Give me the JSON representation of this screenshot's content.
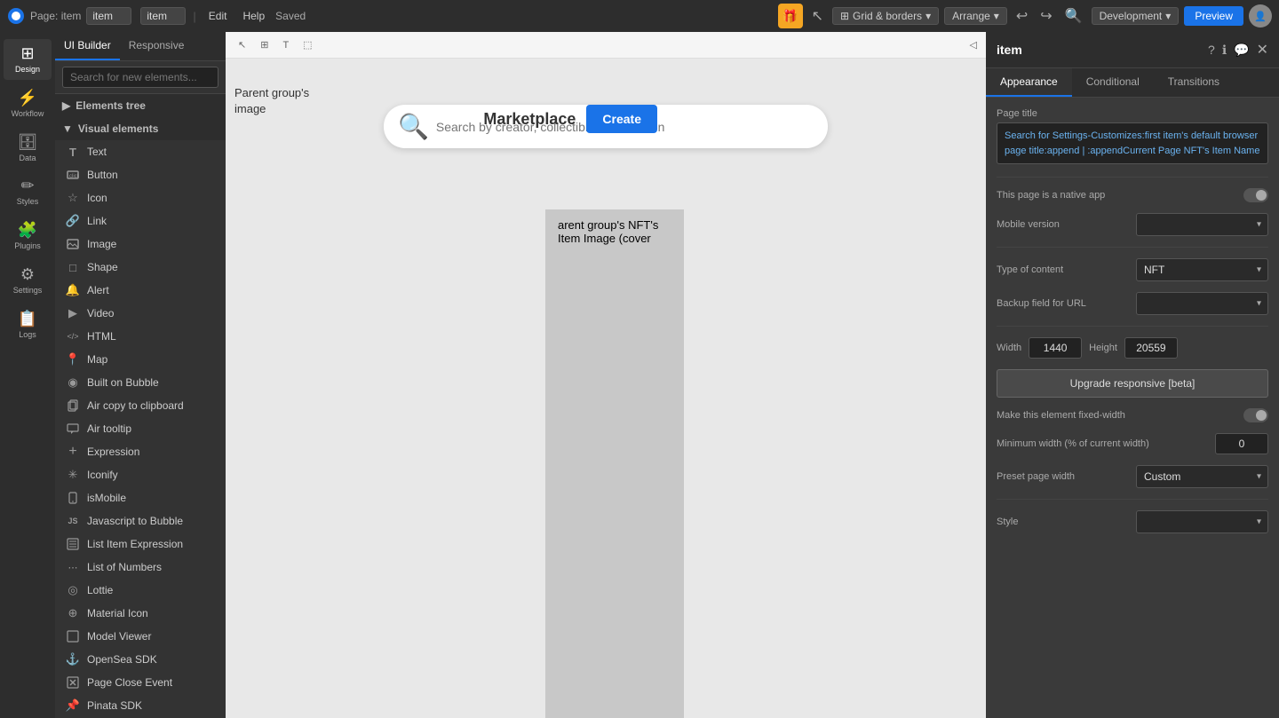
{
  "topbar": {
    "page_label": "Page: item",
    "page_value": "item",
    "edit_label": "Edit",
    "help_label": "Help",
    "saved_label": "Saved",
    "grid_borders_label": "Grid & borders",
    "arrange_label": "Arrange",
    "development_label": "Development",
    "preview_label": "Preview"
  },
  "left_sidebar": {
    "items": [
      {
        "id": "design",
        "label": "Design",
        "icon": "⊞",
        "active": true
      },
      {
        "id": "workflow",
        "label": "Workflow",
        "icon": "⚡"
      },
      {
        "id": "data",
        "label": "Data",
        "icon": "🗄"
      },
      {
        "id": "styles",
        "label": "Styles",
        "icon": "✏️"
      },
      {
        "id": "plugins",
        "label": "Plugins",
        "icon": "🧩"
      },
      {
        "id": "settings",
        "label": "Settings",
        "icon": "⚙"
      },
      {
        "id": "logs",
        "label": "Logs",
        "icon": "📋"
      }
    ]
  },
  "elements_panel": {
    "tabs": [
      {
        "id": "ui-builder",
        "label": "UI Builder",
        "active": true
      },
      {
        "id": "responsive",
        "label": "Responsive"
      }
    ],
    "search_placeholder": "Search for new elements...",
    "tree_label": "Elements tree",
    "visual_elements_label": "Visual elements",
    "elements": [
      {
        "id": "text",
        "label": "Text",
        "icon": "T"
      },
      {
        "id": "button",
        "label": "Button",
        "icon": "⬚"
      },
      {
        "id": "icon",
        "label": "Icon",
        "icon": "★"
      },
      {
        "id": "link",
        "label": "Link",
        "icon": "🔗"
      },
      {
        "id": "image",
        "label": "Image",
        "icon": "🖼"
      },
      {
        "id": "shape",
        "label": "Shape",
        "icon": "□"
      },
      {
        "id": "alert",
        "label": "Alert",
        "icon": "🔔"
      },
      {
        "id": "video",
        "label": "Video",
        "icon": "▶"
      },
      {
        "id": "html",
        "label": "HTML",
        "icon": "</>"
      },
      {
        "id": "map",
        "label": "Map",
        "icon": "📍"
      },
      {
        "id": "built-on-bubble",
        "label": "Built on Bubble",
        "icon": "◉"
      },
      {
        "id": "air-copy",
        "label": "Air copy to clipboard",
        "icon": "📋"
      },
      {
        "id": "air-tooltip",
        "label": "Air tooltip",
        "icon": "💬"
      },
      {
        "id": "expression",
        "label": "Expression",
        "icon": "+"
      },
      {
        "id": "iconify",
        "label": "Iconify",
        "icon": "✳"
      },
      {
        "id": "ismobile",
        "label": "isMobile",
        "icon": "📱"
      },
      {
        "id": "javascript-to-bubble",
        "label": "Javascript to Bubble",
        "icon": "JS"
      },
      {
        "id": "list-item-expression",
        "label": "List Item Expression",
        "icon": "📄"
      },
      {
        "id": "list-of-numbers",
        "label": "List of Numbers",
        "icon": "⋯"
      },
      {
        "id": "lottie",
        "label": "Lottie",
        "icon": "◎"
      },
      {
        "id": "material-icon",
        "label": "Material Icon",
        "icon": "⊕"
      },
      {
        "id": "model-viewer",
        "label": "Model Viewer",
        "icon": "⬜"
      },
      {
        "id": "opensea-sdk",
        "label": "OpenSea SDK",
        "icon": "⚓"
      },
      {
        "id": "page-close-event",
        "label": "Page Close Event",
        "icon": "🚫"
      },
      {
        "id": "pinata-sdk",
        "label": "Pinata SDK",
        "icon": "📌"
      }
    ]
  },
  "canvas": {
    "parent_group_label_line1": "Parent group's",
    "parent_group_label_line2": "image",
    "search_placeholder": "Search by creator, collectible or collection",
    "marketplace_title": "Marketplace",
    "create_btn_label": "Create",
    "nft_area_text": "arent group's NFT's Item Image (cover"
  },
  "right_panel": {
    "title": "item",
    "tabs": [
      {
        "id": "appearance",
        "label": "Appearance",
        "active": true
      },
      {
        "id": "conditional",
        "label": "Conditional"
      },
      {
        "id": "transitions",
        "label": "Transitions"
      }
    ],
    "page_title_label": "Page title",
    "page_title_value": "Search for Settings-Customizes:first item's default browser page title:append | :appendCurrent Page NFT's Item Name",
    "native_app_label": "This page is a native app",
    "mobile_version_label": "Mobile version",
    "type_of_content_label": "Type of content",
    "type_of_content_value": "NFT",
    "backup_url_label": "Backup field for URL",
    "backup_url_value": "",
    "width_label": "Width",
    "width_value": "1440",
    "height_label": "Height",
    "height_value": "20559",
    "upgrade_btn_label": "Upgrade responsive [beta]",
    "fixed_width_label": "Make this element fixed-width",
    "min_width_label": "Minimum width (% of current width)",
    "min_width_value": "0",
    "preset_page_width_label": "Preset page width",
    "preset_page_width_value": "Custom",
    "style_label": "Style",
    "style_value": ""
  }
}
